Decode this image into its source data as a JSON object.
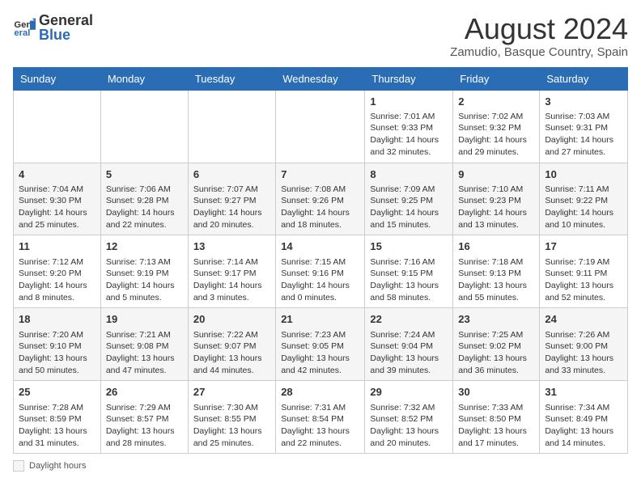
{
  "logo": {
    "general": "General",
    "blue": "Blue"
  },
  "title": "August 2024",
  "subtitle": "Zamudio, Basque Country, Spain",
  "days_of_week": [
    "Sunday",
    "Monday",
    "Tuesday",
    "Wednesday",
    "Thursday",
    "Friday",
    "Saturday"
  ],
  "weeks": [
    [
      {
        "day": "",
        "info": ""
      },
      {
        "day": "",
        "info": ""
      },
      {
        "day": "",
        "info": ""
      },
      {
        "day": "",
        "info": ""
      },
      {
        "day": "1",
        "info": "Sunrise: 7:01 AM\nSunset: 9:33 PM\nDaylight: 14 hours and 32 minutes."
      },
      {
        "day": "2",
        "info": "Sunrise: 7:02 AM\nSunset: 9:32 PM\nDaylight: 14 hours and 29 minutes."
      },
      {
        "day": "3",
        "info": "Sunrise: 7:03 AM\nSunset: 9:31 PM\nDaylight: 14 hours and 27 minutes."
      }
    ],
    [
      {
        "day": "4",
        "info": "Sunrise: 7:04 AM\nSunset: 9:30 PM\nDaylight: 14 hours and 25 minutes."
      },
      {
        "day": "5",
        "info": "Sunrise: 7:06 AM\nSunset: 9:28 PM\nDaylight: 14 hours and 22 minutes."
      },
      {
        "day": "6",
        "info": "Sunrise: 7:07 AM\nSunset: 9:27 PM\nDaylight: 14 hours and 20 minutes."
      },
      {
        "day": "7",
        "info": "Sunrise: 7:08 AM\nSunset: 9:26 PM\nDaylight: 14 hours and 18 minutes."
      },
      {
        "day": "8",
        "info": "Sunrise: 7:09 AM\nSunset: 9:25 PM\nDaylight: 14 hours and 15 minutes."
      },
      {
        "day": "9",
        "info": "Sunrise: 7:10 AM\nSunset: 9:23 PM\nDaylight: 14 hours and 13 minutes."
      },
      {
        "day": "10",
        "info": "Sunrise: 7:11 AM\nSunset: 9:22 PM\nDaylight: 14 hours and 10 minutes."
      }
    ],
    [
      {
        "day": "11",
        "info": "Sunrise: 7:12 AM\nSunset: 9:20 PM\nDaylight: 14 hours and 8 minutes."
      },
      {
        "day": "12",
        "info": "Sunrise: 7:13 AM\nSunset: 9:19 PM\nDaylight: 14 hours and 5 minutes."
      },
      {
        "day": "13",
        "info": "Sunrise: 7:14 AM\nSunset: 9:17 PM\nDaylight: 14 hours and 3 minutes."
      },
      {
        "day": "14",
        "info": "Sunrise: 7:15 AM\nSunset: 9:16 PM\nDaylight: 14 hours and 0 minutes."
      },
      {
        "day": "15",
        "info": "Sunrise: 7:16 AM\nSunset: 9:15 PM\nDaylight: 13 hours and 58 minutes."
      },
      {
        "day": "16",
        "info": "Sunrise: 7:18 AM\nSunset: 9:13 PM\nDaylight: 13 hours and 55 minutes."
      },
      {
        "day": "17",
        "info": "Sunrise: 7:19 AM\nSunset: 9:11 PM\nDaylight: 13 hours and 52 minutes."
      }
    ],
    [
      {
        "day": "18",
        "info": "Sunrise: 7:20 AM\nSunset: 9:10 PM\nDaylight: 13 hours and 50 minutes."
      },
      {
        "day": "19",
        "info": "Sunrise: 7:21 AM\nSunset: 9:08 PM\nDaylight: 13 hours and 47 minutes."
      },
      {
        "day": "20",
        "info": "Sunrise: 7:22 AM\nSunset: 9:07 PM\nDaylight: 13 hours and 44 minutes."
      },
      {
        "day": "21",
        "info": "Sunrise: 7:23 AM\nSunset: 9:05 PM\nDaylight: 13 hours and 42 minutes."
      },
      {
        "day": "22",
        "info": "Sunrise: 7:24 AM\nSunset: 9:04 PM\nDaylight: 13 hours and 39 minutes."
      },
      {
        "day": "23",
        "info": "Sunrise: 7:25 AM\nSunset: 9:02 PM\nDaylight: 13 hours and 36 minutes."
      },
      {
        "day": "24",
        "info": "Sunrise: 7:26 AM\nSunset: 9:00 PM\nDaylight: 13 hours and 33 minutes."
      }
    ],
    [
      {
        "day": "25",
        "info": "Sunrise: 7:28 AM\nSunset: 8:59 PM\nDaylight: 13 hours and 31 minutes."
      },
      {
        "day": "26",
        "info": "Sunrise: 7:29 AM\nSunset: 8:57 PM\nDaylight: 13 hours and 28 minutes."
      },
      {
        "day": "27",
        "info": "Sunrise: 7:30 AM\nSunset: 8:55 PM\nDaylight: 13 hours and 25 minutes."
      },
      {
        "day": "28",
        "info": "Sunrise: 7:31 AM\nSunset: 8:54 PM\nDaylight: 13 hours and 22 minutes."
      },
      {
        "day": "29",
        "info": "Sunrise: 7:32 AM\nSunset: 8:52 PM\nDaylight: 13 hours and 20 minutes."
      },
      {
        "day": "30",
        "info": "Sunrise: 7:33 AM\nSunset: 8:50 PM\nDaylight: 13 hours and 17 minutes."
      },
      {
        "day": "31",
        "info": "Sunrise: 7:34 AM\nSunset: 8:49 PM\nDaylight: 13 hours and 14 minutes."
      }
    ]
  ],
  "footer": {
    "daylight_label": "Daylight hours"
  }
}
